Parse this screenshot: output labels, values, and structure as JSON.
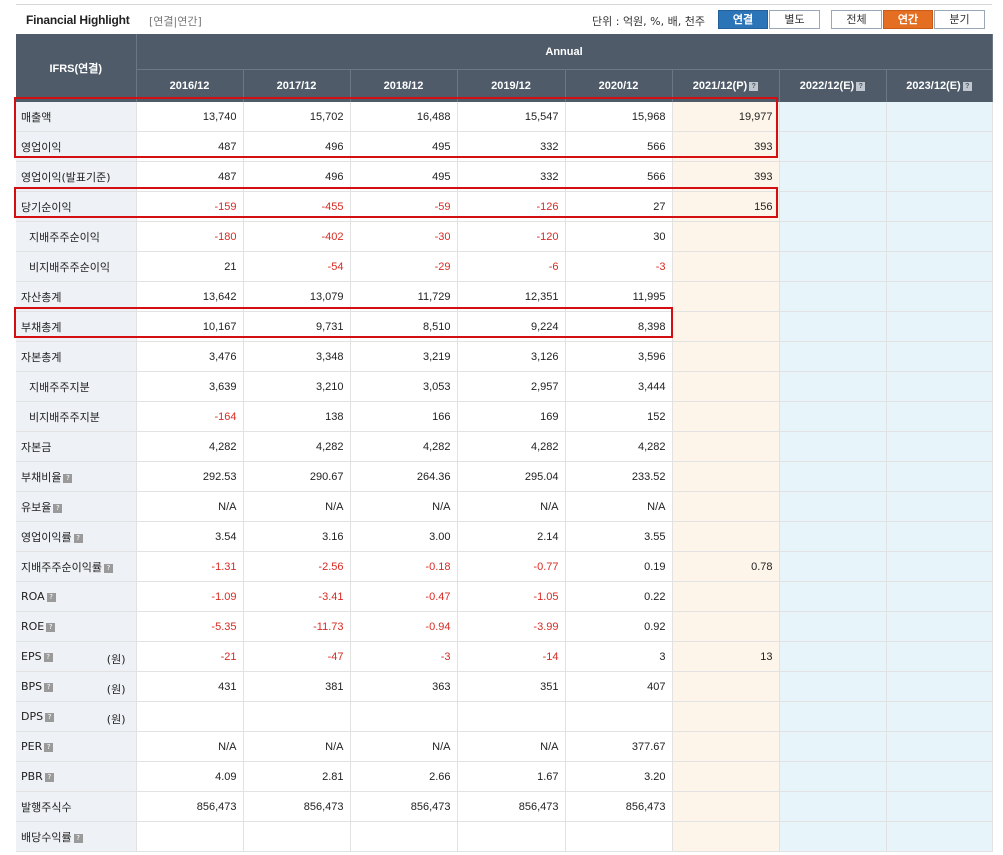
{
  "header": {
    "title": "Financial Highlight",
    "subtitle": "[연결|연간]",
    "unit": "단위 : 억원, %, 배, 천주",
    "buttons": {
      "consolidated": "연결",
      "separate": "별도",
      "all": "전체",
      "annual": "연간",
      "quarter": "분기"
    }
  },
  "table": {
    "corner": "IFRS(연결)",
    "group_header": "Annual",
    "columns": [
      "2016/12",
      "2017/12",
      "2018/12",
      "2019/12",
      "2020/12",
      "2021/12(P)",
      "2022/12(E)",
      "2023/12(E)"
    ],
    "columns_with_help": [
      5,
      6,
      7
    ],
    "help_glyph": "?",
    "rows": [
      {
        "label": "매출액",
        "indent": false,
        "help": false,
        "unit": "",
        "values": [
          "13,740",
          "15,702",
          "16,488",
          "15,547",
          "15,968",
          "19,977",
          "",
          ""
        ]
      },
      {
        "label": "영업이익",
        "indent": false,
        "help": false,
        "unit": "",
        "values": [
          "487",
          "496",
          "495",
          "332",
          "566",
          "393",
          "",
          ""
        ]
      },
      {
        "label": "영업이익(발표기준)",
        "indent": false,
        "help": false,
        "unit": "",
        "values": [
          "487",
          "496",
          "495",
          "332",
          "566",
          "393",
          "",
          ""
        ]
      },
      {
        "label": "당기순이익",
        "indent": false,
        "help": false,
        "unit": "",
        "values": [
          "-159",
          "-455",
          "-59",
          "-126",
          "27",
          "156",
          "",
          ""
        ]
      },
      {
        "label": "지배주주순이익",
        "indent": true,
        "help": false,
        "unit": "",
        "values": [
          "-180",
          "-402",
          "-30",
          "-120",
          "30",
          "",
          "",
          ""
        ]
      },
      {
        "label": "비지배주주순이익",
        "indent": true,
        "help": false,
        "unit": "",
        "values": [
          "21",
          "-54",
          "-29",
          "-6",
          "-3",
          "",
          "",
          ""
        ]
      },
      {
        "label": "자산총계",
        "indent": false,
        "help": false,
        "unit": "",
        "values": [
          "13,642",
          "13,079",
          "11,729",
          "12,351",
          "11,995",
          "",
          "",
          ""
        ]
      },
      {
        "label": "부채총계",
        "indent": false,
        "help": false,
        "unit": "",
        "values": [
          "10,167",
          "9,731",
          "8,510",
          "9,224",
          "8,398",
          "",
          "",
          ""
        ]
      },
      {
        "label": "자본총계",
        "indent": false,
        "help": false,
        "unit": "",
        "values": [
          "3,476",
          "3,348",
          "3,219",
          "3,126",
          "3,596",
          "",
          "",
          ""
        ]
      },
      {
        "label": "지배주주지분",
        "indent": true,
        "help": false,
        "unit": "",
        "values": [
          "3,639",
          "3,210",
          "3,053",
          "2,957",
          "3,444",
          "",
          "",
          ""
        ]
      },
      {
        "label": "비지배주주지분",
        "indent": true,
        "help": false,
        "unit": "",
        "values": [
          "-164",
          "138",
          "166",
          "169",
          "152",
          "",
          "",
          ""
        ]
      },
      {
        "label": "자본금",
        "indent": false,
        "help": false,
        "unit": "",
        "values": [
          "4,282",
          "4,282",
          "4,282",
          "4,282",
          "4,282",
          "",
          "",
          ""
        ]
      },
      {
        "label": "부채비율",
        "indent": false,
        "help": true,
        "unit": "",
        "values": [
          "292.53",
          "290.67",
          "264.36",
          "295.04",
          "233.52",
          "",
          "",
          ""
        ]
      },
      {
        "label": "유보율",
        "indent": false,
        "help": true,
        "unit": "",
        "values": [
          "N/A",
          "N/A",
          "N/A",
          "N/A",
          "N/A",
          "",
          "",
          ""
        ]
      },
      {
        "label": "영업이익률",
        "indent": false,
        "help": true,
        "unit": "",
        "values": [
          "3.54",
          "3.16",
          "3.00",
          "2.14",
          "3.55",
          "",
          "",
          ""
        ]
      },
      {
        "label": "지배주주순이익률",
        "indent": false,
        "help": true,
        "unit": "",
        "values": [
          "-1.31",
          "-2.56",
          "-0.18",
          "-0.77",
          "0.19",
          "0.78",
          "",
          ""
        ]
      },
      {
        "label": "ROA",
        "indent": false,
        "help": true,
        "unit": "",
        "values": [
          "-1.09",
          "-3.41",
          "-0.47",
          "-1.05",
          "0.22",
          "",
          "",
          ""
        ]
      },
      {
        "label": "ROE",
        "indent": false,
        "help": true,
        "unit": "",
        "values": [
          "-5.35",
          "-11.73",
          "-0.94",
          "-3.99",
          "0.92",
          "",
          "",
          ""
        ]
      },
      {
        "label": "EPS",
        "indent": false,
        "help": true,
        "unit": "(원)",
        "values": [
          "-21",
          "-47",
          "-3",
          "-14",
          "3",
          "13",
          "",
          ""
        ]
      },
      {
        "label": "BPS",
        "indent": false,
        "help": true,
        "unit": "(원)",
        "values": [
          "431",
          "381",
          "363",
          "351",
          "407",
          "",
          "",
          ""
        ]
      },
      {
        "label": "DPS",
        "indent": false,
        "help": true,
        "unit": "(원)",
        "values": [
          "",
          "",
          "",
          "",
          "",
          "",
          "",
          ""
        ]
      },
      {
        "label": "PER",
        "indent": false,
        "help": true,
        "unit": "",
        "values": [
          "N/A",
          "N/A",
          "N/A",
          "N/A",
          "377.67",
          "",
          "",
          ""
        ]
      },
      {
        "label": "PBR",
        "indent": false,
        "help": true,
        "unit": "",
        "values": [
          "4.09",
          "2.81",
          "2.66",
          "1.67",
          "3.20",
          "",
          "",
          ""
        ]
      },
      {
        "label": "발행주식수",
        "indent": false,
        "help": false,
        "unit": "",
        "values": [
          "856,473",
          "856,473",
          "856,473",
          "856,473",
          "856,473",
          "",
          "",
          ""
        ]
      },
      {
        "label": "배당수익률",
        "indent": false,
        "help": true,
        "unit": "",
        "values": [
          "",
          "",
          "",
          "",
          "",
          "",
          "",
          ""
        ]
      }
    ]
  },
  "colors": {
    "header_bg": "#4f5b69",
    "negative": "#d72b23",
    "highlight_box": "#d40f12",
    "provisional_col_bg": "#fdf5ea",
    "estimate_col_bg": "#e7f5fa",
    "btn_blue": "#2b74b8",
    "btn_orange": "#e46e22"
  }
}
